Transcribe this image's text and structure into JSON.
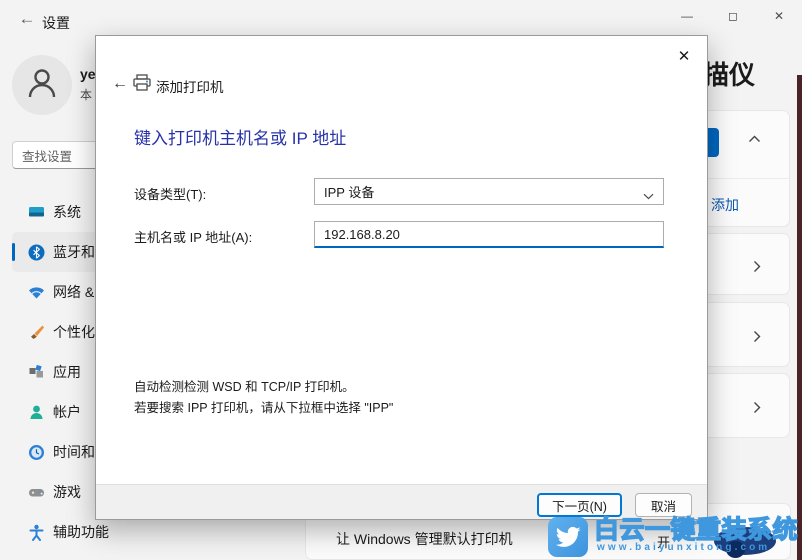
{
  "titlebar": {
    "back_icon": "←",
    "title": "设置",
    "minimize": "—",
    "maximize": "◻",
    "close": "✕"
  },
  "user": {
    "name": "ye",
    "subtitle": "本"
  },
  "search": {
    "placeholder": "查找设置"
  },
  "sidebar": {
    "items": [
      {
        "label": "系统"
      },
      {
        "label": "蓝牙和",
        "selected": true
      },
      {
        "label": "网络 &"
      },
      {
        "label": "个性化"
      },
      {
        "label": "应用"
      },
      {
        "label": "帐户"
      },
      {
        "label": "时间和"
      },
      {
        "label": "游戏"
      },
      {
        "label": "辅助功能"
      }
    ]
  },
  "content": {
    "page_title": "描仪",
    "add_label": "添加",
    "default_printer_row": "让 Windows 管理默认打印机",
    "toggle_label": "开"
  },
  "dialog": {
    "back_icon": "←",
    "title": "添加打印机",
    "close_icon": "✕",
    "heading": "键入打印机主机名或 IP 地址",
    "device_type_label": "设备类型(T):",
    "device_type_value": "IPP 设备",
    "hostname_label": "主机名或 IP 地址(A):",
    "hostname_value": "192.168.8.20",
    "hint_line1": "自动检测检测 WSD 和 TCP/IP 打印机。",
    "hint_line2": "若要搜索 IPP 打印机，请从下拉框中选择 \"IPP\"",
    "next_button": "下一页(N)",
    "cancel_button": "取消"
  },
  "watermark": {
    "brand": "白云一键重装系统",
    "url": "www.baiyunxitong.com"
  },
  "colors": {
    "accent": "#0067c0",
    "wizard_heading": "#2832a8",
    "watermark_blue": "#3f97dd",
    "edge_strip": "#4a2329"
  }
}
